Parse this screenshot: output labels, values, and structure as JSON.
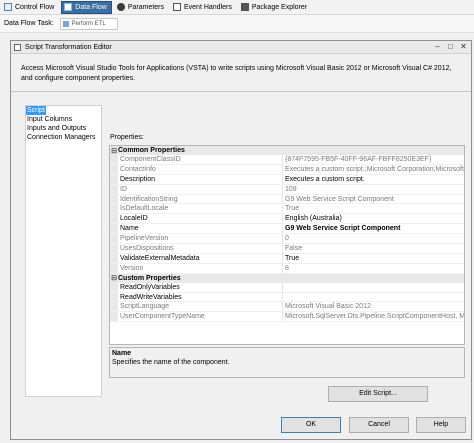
{
  "tabs": [
    {
      "label": "Control Flow",
      "icon": "control-flow-icon",
      "active": false
    },
    {
      "label": "Data Flow",
      "icon": "data-flow-icon",
      "active": true
    },
    {
      "label": "Parameters",
      "icon": "parameters-icon",
      "active": false
    },
    {
      "label": "Event Handlers",
      "icon": "event-handlers-icon",
      "active": false
    },
    {
      "label": "Package Explorer",
      "icon": "package-explorer-icon",
      "active": false
    }
  ],
  "task": {
    "label": "Data Flow Task:",
    "value": "Perform ETL"
  },
  "dialog": {
    "title": "Script Transformation Editor",
    "intro": "Access Microsoft Visual Studio Tools for Applications (VSTA) to write scripts using Microsoft Visual Basic 2012 or Microsoft Visual C# 2012, and configure component properties.",
    "nav": [
      "Script",
      "Input Columns",
      "Inputs and Outputs",
      "Connection Managers"
    ],
    "properties_label": "Properties:",
    "categories": {
      "common": "Common Properties",
      "custom": "Custom Properties"
    },
    "common_rows": [
      {
        "name": "ComponentClassID",
        "value": "{874F7595-FB5F-40FF-96AF-FBFF8250E3EF}",
        "readonly": true
      },
      {
        "name": "ContactInfo",
        "value": "Executes a custom script.;Microsoft Corporation;Microsoft SQ",
        "readonly": true
      },
      {
        "name": "Description",
        "value": "Executes a custom script.",
        "readonly": false
      },
      {
        "name": "ID",
        "value": "109",
        "readonly": true
      },
      {
        "name": "IdentificationString",
        "value": "G9 Web Service Script Component",
        "readonly": true
      },
      {
        "name": "IsDefaultLocale",
        "value": "True",
        "readonly": true
      },
      {
        "name": "LocaleID",
        "value": "English (Australia)",
        "readonly": false
      },
      {
        "name": "Name",
        "value": "G9 Web Service Script Component",
        "readonly": false,
        "bold": true
      },
      {
        "name": "PipelineVersion",
        "value": "0",
        "readonly": true
      },
      {
        "name": "UsesDispositions",
        "value": "False",
        "readonly": true
      },
      {
        "name": "ValidateExternalMetadata",
        "value": "True",
        "readonly": false
      },
      {
        "name": "Version",
        "value": "8",
        "readonly": true
      }
    ],
    "custom_rows": [
      {
        "name": "ReadOnlyVariables",
        "value": "",
        "readonly": false
      },
      {
        "name": "ReadWriteVariables",
        "value": "",
        "readonly": false
      },
      {
        "name": "ScriptLanguage",
        "value": "Microsoft Visual Basic 2012",
        "readonly": true
      },
      {
        "name": "UserComponentTypeName",
        "value": "Microsoft.SqlServer.Dts.Pipeline.ScriptComponentHost, Mic",
        "readonly": true
      }
    ],
    "description_title": "Name",
    "description_text": "Specifies the name of the component.",
    "edit_script": "Edit Script...",
    "ok": "OK",
    "cancel": "Cancel",
    "help": "Help"
  }
}
